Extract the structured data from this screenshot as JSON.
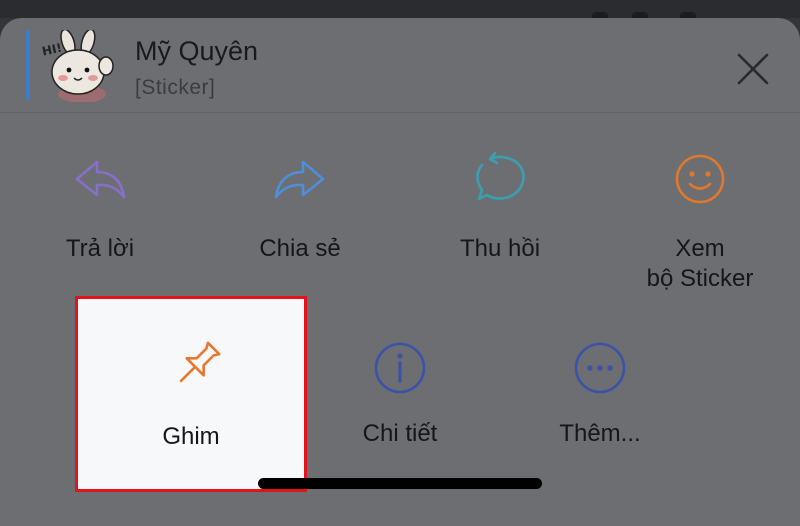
{
  "header": {
    "sender_name": "Mỹ Quyên",
    "message_type": "[Sticker]",
    "sticker_text": "HI!"
  },
  "actions_row1": [
    {
      "label": "Trả lời",
      "icon": "reply-arrow-icon",
      "color": "#8670c9"
    },
    {
      "label": "Chia sẻ",
      "icon": "share-arrow-icon",
      "color": "#4f8ed9"
    },
    {
      "label": "Thu hồi",
      "icon": "recall-bubble-icon",
      "color": "#3aa0b0"
    },
    {
      "label": "Xem\nbộ Sticker",
      "icon": "smiley-face-icon",
      "color": "#e0782d"
    }
  ],
  "actions_row2": [
    {
      "label": "Ghim",
      "icon": "pin-icon",
      "color": "#e8772e",
      "highlighted": true
    },
    {
      "label": "Chi tiết",
      "icon": "info-circle-icon",
      "color": "#3a52a8"
    },
    {
      "label": "Thêm...",
      "icon": "more-dots-icon",
      "color": "#3a52a8"
    }
  ],
  "colors": {
    "sheet_background": "#6d6e72",
    "highlight_border": "#e2131c",
    "accent_bar": "#3e7dc8"
  }
}
